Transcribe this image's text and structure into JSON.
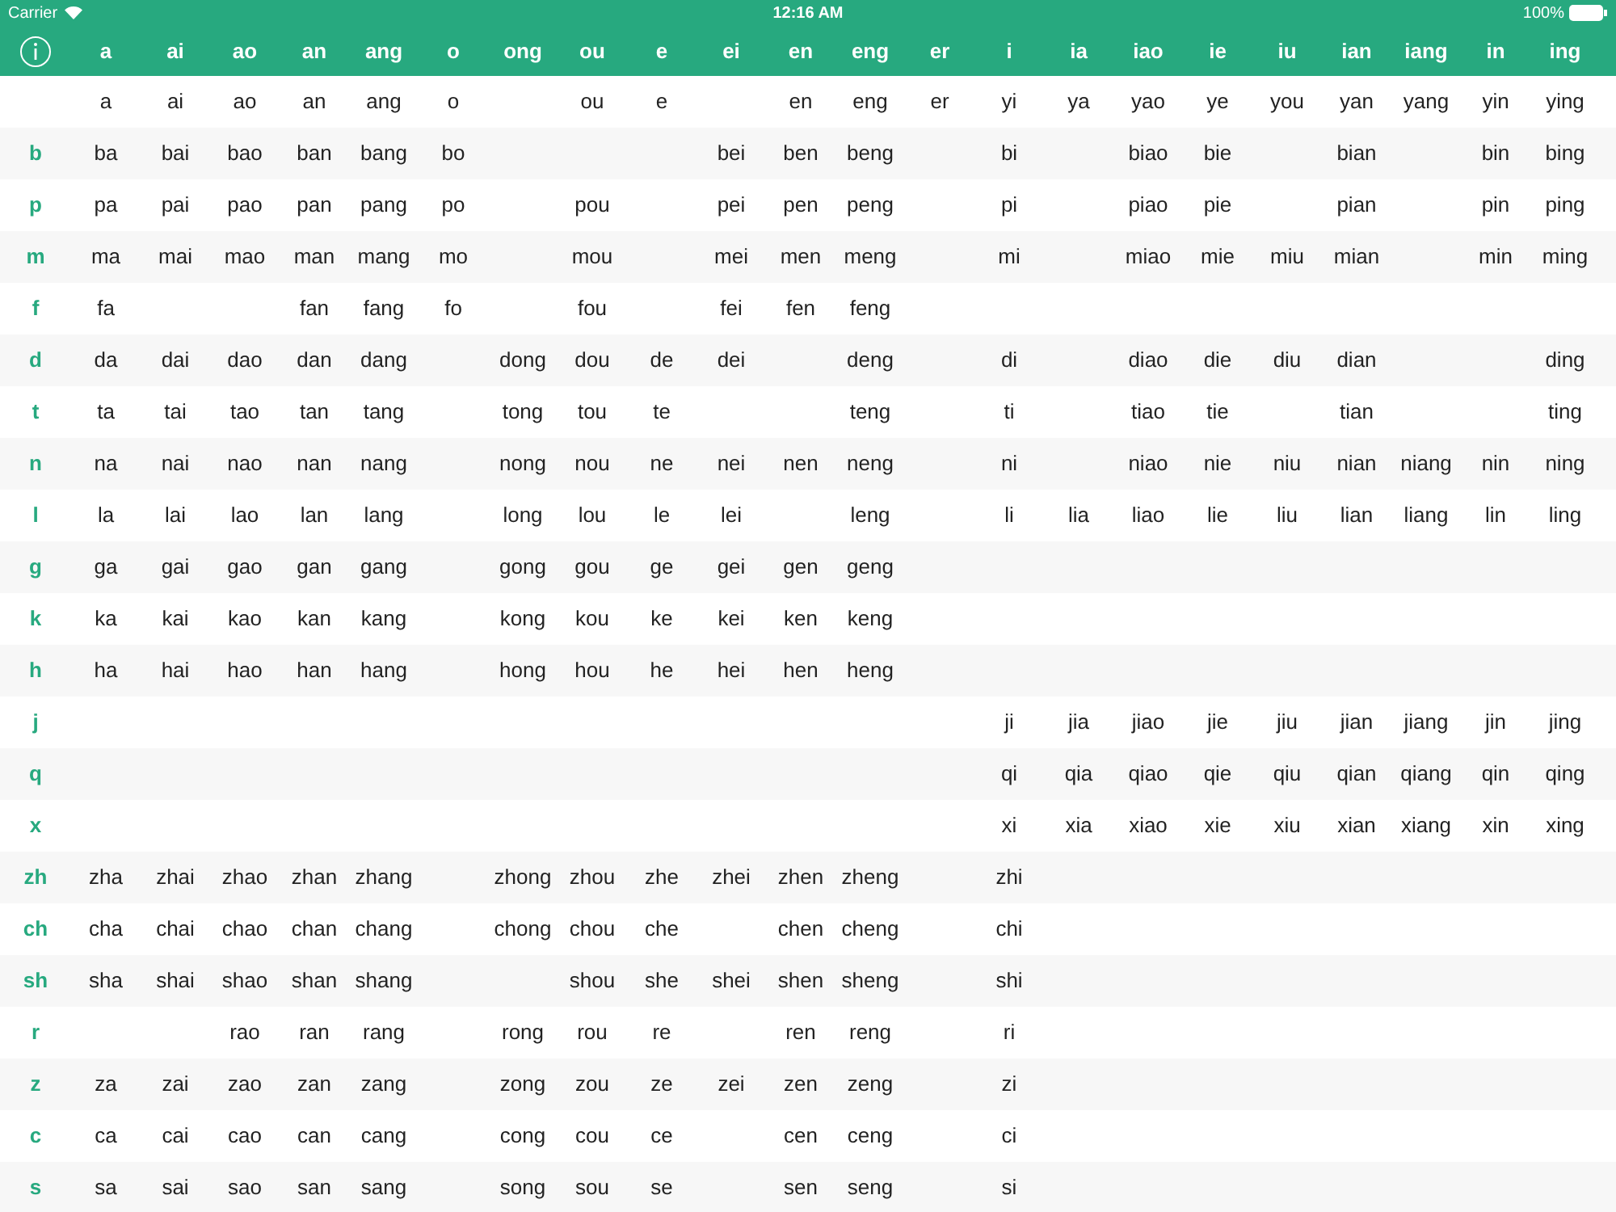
{
  "status_bar": {
    "carrier": "Carrier",
    "time": "12:16 AM",
    "battery": "100%"
  },
  "columns": [
    "a",
    "ai",
    "ao",
    "an",
    "ang",
    "o",
    "ong",
    "ou",
    "e",
    "ei",
    "en",
    "eng",
    "er",
    "i",
    "ia",
    "iao",
    "ie",
    "iu",
    "ian",
    "iang",
    "in",
    "ing"
  ],
  "rows": [
    {
      "cells": [
        "a",
        "ai",
        "ao",
        "an",
        "ang",
        "o",
        null,
        "ou",
        "e",
        null,
        "en",
        "eng",
        "er",
        "yi",
        "ya",
        "yao",
        "ye",
        "you",
        "yan",
        "yang",
        "yin",
        "ying"
      ]
    },
    {
      "initial": "b",
      "cells": [
        "ba",
        "bai",
        "bao",
        "ban",
        "bang",
        "bo",
        null,
        null,
        null,
        "bei",
        "ben",
        "beng",
        null,
        "bi",
        null,
        "biao",
        "bie",
        null,
        "bian",
        null,
        "bin",
        "bing"
      ]
    },
    {
      "initial": "p",
      "cells": [
        "pa",
        "pai",
        "pao",
        "pan",
        "pang",
        "po",
        null,
        "pou",
        null,
        "pei",
        "pen",
        "peng",
        null,
        "pi",
        null,
        "piao",
        "pie",
        null,
        "pian",
        null,
        "pin",
        "ping"
      ]
    },
    {
      "initial": "m",
      "cells": [
        "ma",
        "mai",
        "mao",
        "man",
        "mang",
        "mo",
        null,
        "mou",
        null,
        "mei",
        "men",
        "meng",
        null,
        "mi",
        null,
        "miao",
        "mie",
        "miu",
        "mian",
        null,
        "min",
        "ming"
      ]
    },
    {
      "initial": "f",
      "cells": [
        "fa",
        null,
        null,
        "fan",
        "fang",
        "fo",
        null,
        "fou",
        null,
        "fei",
        "fen",
        "feng"
      ]
    },
    {
      "initial": "d",
      "cells": [
        "da",
        "dai",
        "dao",
        "dan",
        "dang",
        null,
        "dong",
        "dou",
        "de",
        "dei",
        null,
        "deng",
        null,
        "di",
        null,
        "diao",
        "die",
        "diu",
        "dian",
        null,
        null,
        "ding"
      ]
    },
    {
      "initial": "t",
      "cells": [
        "ta",
        "tai",
        "tao",
        "tan",
        "tang",
        null,
        "tong",
        "tou",
        "te",
        null,
        null,
        "teng",
        null,
        "ti",
        null,
        "tiao",
        "tie",
        null,
        "tian",
        null,
        null,
        "ting"
      ]
    },
    {
      "initial": "n",
      "cells": [
        "na",
        "nai",
        "nao",
        "nan",
        "nang",
        null,
        "nong",
        "nou",
        "ne",
        "nei",
        "nen",
        "neng",
        null,
        "ni",
        null,
        "niao",
        "nie",
        "niu",
        "nian",
        "niang",
        "nin",
        "ning"
      ]
    },
    {
      "initial": "l",
      "cells": [
        "la",
        "lai",
        "lao",
        "lan",
        "lang",
        null,
        "long",
        "lou",
        "le",
        "lei",
        null,
        "leng",
        null,
        "li",
        "lia",
        "liao",
        "lie",
        "liu",
        "lian",
        "liang",
        "lin",
        "ling"
      ]
    },
    {
      "initial": "g",
      "cells": [
        "ga",
        "gai",
        "gao",
        "gan",
        "gang",
        null,
        "gong",
        "gou",
        "ge",
        "gei",
        "gen",
        "geng"
      ]
    },
    {
      "initial": "k",
      "cells": [
        "ka",
        "kai",
        "kao",
        "kan",
        "kang",
        null,
        "kong",
        "kou",
        "ke",
        "kei",
        "ken",
        "keng"
      ]
    },
    {
      "initial": "h",
      "cells": [
        "ha",
        "hai",
        "hao",
        "han",
        "hang",
        null,
        "hong",
        "hou",
        "he",
        "hei",
        "hen",
        "heng"
      ]
    },
    {
      "initial": "j",
      "cells": [
        null,
        null,
        null,
        null,
        null,
        null,
        null,
        null,
        null,
        null,
        null,
        null,
        null,
        "ji",
        "jia",
        "jiao",
        "jie",
        "jiu",
        "jian",
        "jiang",
        "jin",
        "jing"
      ]
    },
    {
      "initial": "q",
      "cells": [
        null,
        null,
        null,
        null,
        null,
        null,
        null,
        null,
        null,
        null,
        null,
        null,
        null,
        "qi",
        "qia",
        "qiao",
        "qie",
        "qiu",
        "qian",
        "qiang",
        "qin",
        "qing"
      ]
    },
    {
      "initial": "x",
      "cells": [
        null,
        null,
        null,
        null,
        null,
        null,
        null,
        null,
        null,
        null,
        null,
        null,
        null,
        "xi",
        "xia",
        "xiao",
        "xie",
        "xiu",
        "xian",
        "xiang",
        "xin",
        "xing"
      ]
    },
    {
      "initial": "zh",
      "cells": [
        "zha",
        "zhai",
        "zhao",
        "zhan",
        "zhang",
        null,
        "zhong",
        "zhou",
        "zhe",
        "zhei",
        "zhen",
        "zheng",
        null,
        "zhi"
      ]
    },
    {
      "initial": "ch",
      "cells": [
        "cha",
        "chai",
        "chao",
        "chan",
        "chang",
        null,
        "chong",
        "chou",
        "che",
        null,
        "chen",
        "cheng",
        null,
        "chi"
      ]
    },
    {
      "initial": "sh",
      "cells": [
        "sha",
        "shai",
        "shao",
        "shan",
        "shang",
        null,
        null,
        "shou",
        "she",
        "shei",
        "shen",
        "sheng",
        null,
        "shi"
      ]
    },
    {
      "initial": "r",
      "cells": [
        null,
        null,
        "rao",
        "ran",
        "rang",
        null,
        "rong",
        "rou",
        "re",
        null,
        "ren",
        "reng",
        null,
        "ri"
      ]
    },
    {
      "initial": "z",
      "cells": [
        "za",
        "zai",
        "zao",
        "zan",
        "zang",
        null,
        "zong",
        "zou",
        "ze",
        "zei",
        "zen",
        "zeng",
        null,
        "zi"
      ]
    },
    {
      "initial": "c",
      "cells": [
        "ca",
        "cai",
        "cao",
        "can",
        "cang",
        null,
        "cong",
        "cou",
        "ce",
        null,
        "cen",
        "ceng",
        null,
        "ci"
      ]
    },
    {
      "initial": "s",
      "cells": [
        "sa",
        "sai",
        "sao",
        "san",
        "sang",
        null,
        "song",
        "sou",
        "se",
        null,
        "sen",
        "seng",
        null,
        "si"
      ]
    }
  ]
}
